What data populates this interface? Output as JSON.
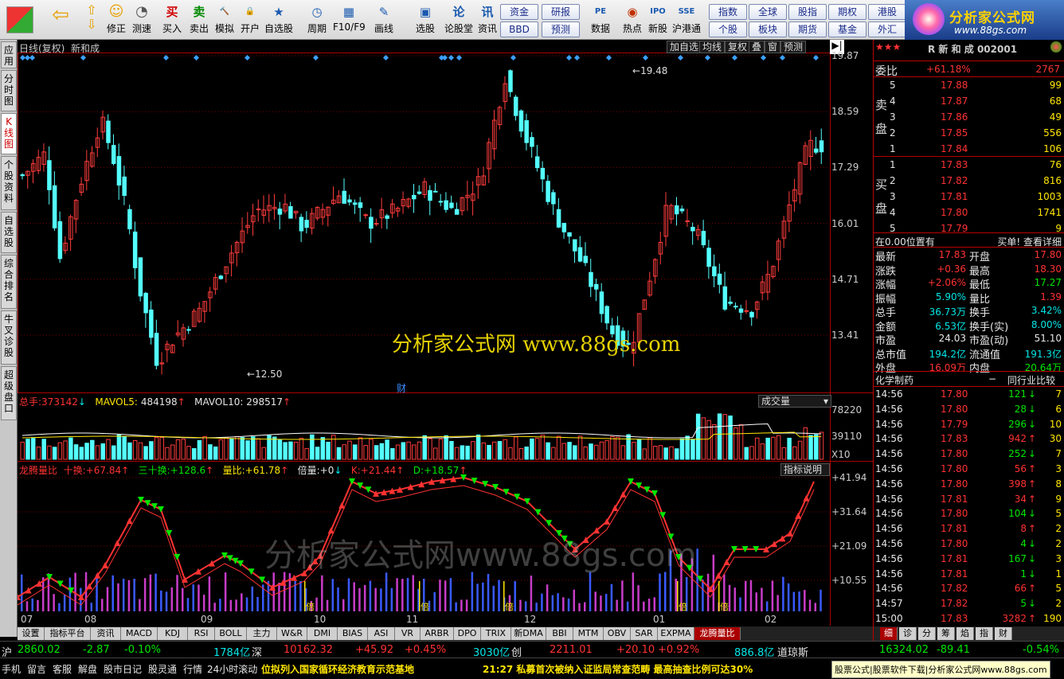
{
  "toolbar": {
    "buttons": [
      {
        "name": "buy",
        "label": "买入",
        "glyph": "买",
        "color": "#d00000"
      },
      {
        "name": "sell",
        "label": "卖出",
        "glyph": "卖",
        "color": "#008800"
      },
      {
        "name": "simulate",
        "label": "模拟",
        "glyph": "🔨",
        "color": "#7a3b00"
      },
      {
        "name": "open-account",
        "label": "开户",
        "glyph": "🔒",
        "color": "#555555"
      },
      {
        "name": "watchlist",
        "label": "自选股",
        "glyph": "★",
        "color": "#1a5ab0"
      },
      {
        "name": "period",
        "label": "周期",
        "glyph": "◷",
        "color": "#1a5ab0"
      },
      {
        "name": "f10",
        "label": "F10/F9",
        "glyph": "▦",
        "color": "#1a5ab0"
      },
      {
        "name": "draw",
        "label": "画线",
        "glyph": "✎",
        "color": "#1a5ab0"
      },
      {
        "name": "stock-pick",
        "label": "选股",
        "glyph": "▣",
        "color": "#1a5ab0"
      },
      {
        "name": "forum",
        "label": "论股堂",
        "glyph": "论",
        "color": "#1a5ab0"
      },
      {
        "name": "news",
        "label": "资讯",
        "glyph": "讯",
        "color": "#1a5ab0"
      },
      {
        "name": "data",
        "label": "数据",
        "glyph": "PE",
        "color": "#1a5ab0"
      },
      {
        "name": "hot",
        "label": "热点",
        "glyph": "◉",
        "color": "#c03000"
      },
      {
        "name": "new-stock",
        "label": "新股",
        "glyph": "IPO",
        "color": "#1a5ab0"
      },
      {
        "name": "hk-connect",
        "label": "沪港通",
        "glyph": "SSE",
        "color": "#1a5ab0"
      }
    ],
    "nav": {
      "back_glyph": "⇦",
      "up_glyph": "⇧",
      "down_glyph": "⇩",
      "fix_label": "修正",
      "fix_glyph": "☺",
      "test_label": "测速",
      "test_glyph": "◔"
    },
    "small": [
      [
        "资金",
        "研报"
      ],
      [
        "BBD",
        "预测"
      ],
      [
        "指数",
        "全球",
        "股指",
        "期权",
        "港股"
      ],
      [
        "个股",
        "板块",
        "期货",
        "基金",
        "外汇"
      ]
    ]
  },
  "brand": {
    "name": "分析家公式网",
    "url": "www.88gs.com"
  },
  "lefttabs": [
    {
      "name": "apply",
      "label": "应用"
    },
    {
      "name": "timeshare",
      "label": "分时图"
    },
    {
      "name": "kline",
      "label": "K线图"
    },
    {
      "name": "profile",
      "label": "个股资料"
    },
    {
      "name": "watch",
      "label": "自选股"
    },
    {
      "name": "rank",
      "label": "综合排名"
    },
    {
      "name": "diagnose",
      "label": "牛叉诊股"
    },
    {
      "name": "super",
      "label": "超级盘口"
    }
  ],
  "chart": {
    "title": "日线(复权)",
    "stock": "新和成",
    "buttons": [
      "加自选",
      "均线",
      "复权",
      "叠",
      "窗",
      "预测"
    ],
    "yaxis": [
      "19.87",
      "18.59",
      "17.29",
      "16.01",
      "14.71",
      "13.41"
    ],
    "high_label": "19.48",
    "low_label": "12.50",
    "watermark1": "分析家公式网 www.88gs.com",
    "watermark2": "分析家公式网www.88gs.com",
    "fin_marker": "财",
    "vol": {
      "total_label": "总手:",
      "total": "373142",
      "ma5_label": "MAVOL5:",
      "ma5": "484198",
      "ma10_label": "MAVOL10:",
      "ma10": "298517",
      "combo": "成交量",
      "y": [
        "78220",
        "39110"
      ],
      "unit": "X10"
    },
    "ind": {
      "name": "龙腾量比",
      "shi_label": "十换:",
      "shi": "+67.84",
      "san_label": "三十换:",
      "san": "+128.6",
      "lb_label": "量比:",
      "lb": "+61.78",
      "bl_label": "倍量:",
      "bl": "+0",
      "k_label": "K:",
      "k": "+21.44",
      "d_label": "D:",
      "d": "+18.57",
      "help": "指标说明",
      "y": [
        "+41.94",
        "+31.64",
        "+21.09",
        "+10.55"
      ],
      "marker": "倍"
    },
    "months": [
      "07",
      "08",
      "09",
      "10",
      "11",
      "12",
      "01",
      "02"
    ]
  },
  "bottom_tabs": [
    "设置",
    "指标平台",
    "资讯",
    "MACD",
    "KDJ",
    "RSI",
    "BOLL",
    "主力",
    "W&R",
    "DMI",
    "BIAS",
    "ASI",
    "VR",
    "ARBR",
    "DPO",
    "TRIX",
    "新DMA",
    "BBI",
    "MTM",
    "OBV",
    "SAR",
    "EXPMA",
    "龙腾量比"
  ],
  "quote": {
    "header_code": "R 新 和 成 002001",
    "weibi_label": "委比",
    "weibi": "+61.18%",
    "weicha": "2767",
    "sell_label": "卖盘",
    "buy_label": "买盘",
    "asks": [
      [
        "5",
        "17.88",
        "99"
      ],
      [
        "4",
        "17.87",
        "68"
      ],
      [
        "3",
        "17.86",
        "49"
      ],
      [
        "2",
        "17.85",
        "556"
      ],
      [
        "1",
        "17.84",
        "106"
      ]
    ],
    "bids": [
      [
        "1",
        "17.83",
        "76"
      ],
      [
        "2",
        "17.82",
        "816"
      ],
      [
        "3",
        "17.81",
        "1003"
      ],
      [
        "4",
        "17.80",
        "1741"
      ],
      [
        "5",
        "17.79",
        "9"
      ]
    ],
    "pos_text": "在0.00位置有",
    "detail": "买单! 查看详细",
    "stats": [
      [
        "最新",
        "17.83",
        "red",
        "开盘",
        "17.80",
        "red"
      ],
      [
        "涨跌",
        "+0.36",
        "red",
        "最高",
        "18.30",
        "red"
      ],
      [
        "涨幅",
        "+2.06%",
        "red",
        "最低",
        "17.27",
        "grn"
      ],
      [
        "振幅",
        "5.90%",
        "cyan",
        "量比",
        "1.39",
        "red"
      ],
      [
        "总手",
        "36.73万",
        "cyan",
        "换手",
        "3.42%",
        "cyan"
      ],
      [
        "金额",
        "6.53亿",
        "cyan",
        "换手(实)",
        "8.00%",
        "cyan"
      ],
      [
        "市盈",
        "24.03",
        "wht",
        "市盈(动)",
        "51.10",
        "wht"
      ],
      [
        "总市值",
        "194.2亿",
        "cyan",
        "流通值",
        "191.3亿",
        "cyan"
      ],
      [
        "外盘",
        "16.09万",
        "red",
        "内盘",
        "20.64万",
        "grn"
      ]
    ],
    "industry": "化学制药",
    "industry_cmp": "同行业比较",
    "ticks": [
      [
        "14:56",
        "17.80",
        "121",
        "g",
        "7"
      ],
      [
        "14:56",
        "17.80",
        "28",
        "g",
        "6"
      ],
      [
        "14:56",
        "17.79",
        "296",
        "g",
        "10"
      ],
      [
        "14:56",
        "17.83",
        "942",
        "r",
        "30"
      ],
      [
        "14:56",
        "17.80",
        "252",
        "g",
        "7"
      ],
      [
        "14:56",
        "17.80",
        "56",
        "r",
        "3"
      ],
      [
        "14:56",
        "17.80",
        "398",
        "r",
        "8"
      ],
      [
        "14:56",
        "17.81",
        "34",
        "r",
        "9"
      ],
      [
        "14:56",
        "17.80",
        "104",
        "g",
        "5"
      ],
      [
        "14:56",
        "17.81",
        "8",
        "r",
        "2"
      ],
      [
        "14:56",
        "17.80",
        "4",
        "g",
        "2"
      ],
      [
        "14:56",
        "17.81",
        "167",
        "g",
        "3"
      ],
      [
        "14:56",
        "17.81",
        "1",
        "g",
        "1"
      ],
      [
        "14:56",
        "17.82",
        "66",
        "r",
        "5"
      ],
      [
        "14:57",
        "17.82",
        "5",
        "g",
        "2"
      ],
      [
        "15:00",
        "17.83",
        "3282",
        "r",
        "190"
      ]
    ],
    "tabs": [
      "细",
      "诊",
      "分",
      "筹",
      "焰",
      "指",
      "财"
    ]
  },
  "status": {
    "sh_label": "沪",
    "sh_idx": "2860.02",
    "sh_chg": "-2.87",
    "sh_pct": "-0.10%",
    "sh_amt": "1784亿",
    "sz_label": "深",
    "sz_idx": "10162.32",
    "sz_chg": "+45.92",
    "sz_pct": "+0.45%",
    "sz_amt": "3030亿",
    "cy_label": "创",
    "cy_idx": "2211.01",
    "cy_chg": "+20.10",
    "cy_pct": "+0.92%",
    "cy_amt": "886.8亿",
    "dj_label": "道琼斯",
    "dj_idx": "16324.02",
    "dj_chg": "-89.41",
    "dj_pct": "-0.54%",
    "links": [
      "手机",
      "留言",
      "客服",
      "解盘",
      "股市日记",
      "股灵通",
      "行情",
      "24小时滚动"
    ],
    "news1": "位拟列入国家循环经济教育示范基地",
    "news2": "21:27 私募首次被纳入证监局常查范畴 最高抽查比例可达30%",
    "ad": "股票公式|股票软件下载|分析家公式网www.88gs.com"
  }
}
